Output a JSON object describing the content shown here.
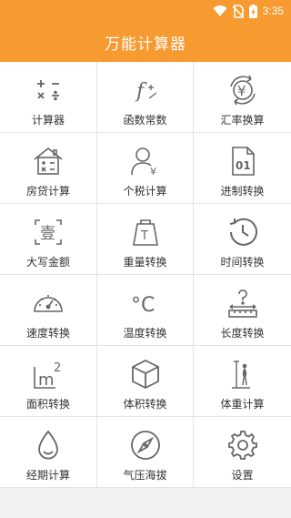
{
  "status": {
    "time": "3:35"
  },
  "app": {
    "title": "万能计算器"
  },
  "items": [
    {
      "label": "计算器",
      "icon": "calculator-symbols-icon"
    },
    {
      "label": "函数常数",
      "icon": "function-icon"
    },
    {
      "label": "汇率换算",
      "icon": "yen-exchange-icon"
    },
    {
      "label": "房贷计算",
      "icon": "house-calculator-icon"
    },
    {
      "label": "个税计算",
      "icon": "person-tax-icon"
    },
    {
      "label": "进制转换",
      "icon": "binary-file-icon"
    },
    {
      "label": "大写金额",
      "icon": "capital-amount-icon"
    },
    {
      "label": "重量转换",
      "icon": "weight-icon"
    },
    {
      "label": "时间转换",
      "icon": "clock-history-icon"
    },
    {
      "label": "速度转换",
      "icon": "speedometer-icon"
    },
    {
      "label": "温度转换",
      "icon": "celsius-icon"
    },
    {
      "label": "长度转换",
      "icon": "ruler-question-icon"
    },
    {
      "label": "面积转换",
      "icon": "square-meter-icon"
    },
    {
      "label": "体积转换",
      "icon": "cube-icon"
    },
    {
      "label": "体重计算",
      "icon": "body-weight-icon"
    },
    {
      "label": "经期计算",
      "icon": "drop-icon"
    },
    {
      "label": "气压海拔",
      "icon": "compass-icon"
    },
    {
      "label": "设置",
      "icon": "gear-icon"
    }
  ],
  "icon_text": {
    "yen": "¥",
    "binary": "01",
    "capital": "壹",
    "weight_t": "T",
    "celsius": "°C",
    "m2_base": "m",
    "m2_exp": "2",
    "tax_char": "¥",
    "func": "f"
  },
  "colors": {
    "accent": "#f79a30",
    "icon": "#666666"
  }
}
